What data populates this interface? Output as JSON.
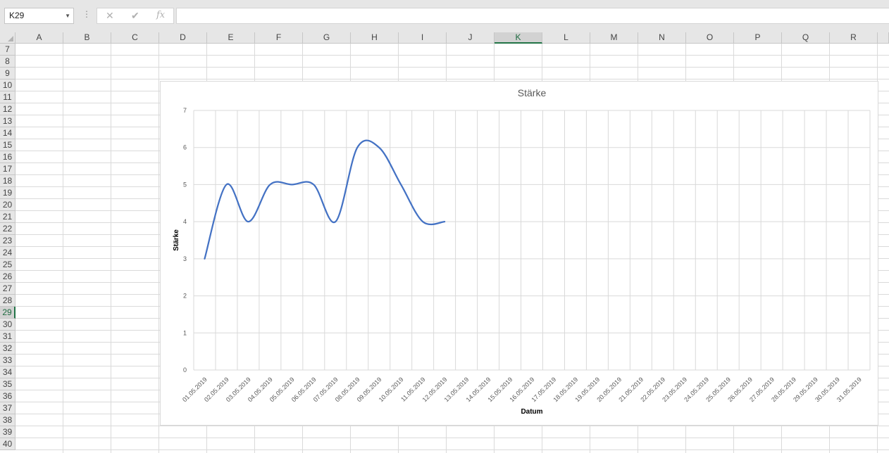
{
  "formula_bar": {
    "name_box": "K29",
    "cancel_icon": "✕",
    "enter_icon": "✔",
    "fx_icon": "fx",
    "formula_value": ""
  },
  "sheet": {
    "selected_cell": "K29",
    "columns": [
      "A",
      "B",
      "C",
      "D",
      "E",
      "F",
      "G",
      "H",
      "I",
      "J",
      "K",
      "L",
      "M",
      "N",
      "O",
      "P",
      "Q",
      "R"
    ],
    "rows": [
      "7",
      "8",
      "9",
      "10",
      "11",
      "12",
      "13",
      "14",
      "15",
      "16",
      "17",
      "18",
      "19",
      "20",
      "21",
      "22",
      "23",
      "24",
      "25",
      "26",
      "27",
      "28",
      "29",
      "30",
      "31",
      "32",
      "33",
      "34",
      "35",
      "36",
      "37",
      "38",
      "39",
      "40"
    ],
    "selected_column": "K",
    "selected_row": "29",
    "accent_color": "#217346"
  },
  "chart_data": {
    "type": "line",
    "title": "Stärke",
    "xlabel": "Datum",
    "ylabel": "Stärke",
    "ylim": [
      0,
      7
    ],
    "yticks": [
      "0",
      "1",
      "2",
      "3",
      "4",
      "5",
      "6",
      "7"
    ],
    "categories": [
      "01.05.2019",
      "02.05.2019",
      "03.05.2019",
      "04.05.2019",
      "05.05.2019",
      "06.05.2019",
      "07.05.2019",
      "08.05.2019",
      "09.05.2019",
      "10.05.2019",
      "11.05.2019",
      "12.05.2019",
      "13.05.2019",
      "14.05.2019",
      "15.05.2019",
      "16.05.2019",
      "17.05.2019",
      "18.05.2019",
      "19.05.2019",
      "20.05.2019",
      "21.05.2019",
      "22.05.2019",
      "23.05.2019",
      "24.05.2019",
      "25.05.2019",
      "26.05.2019",
      "27.05.2019",
      "28.05.2019",
      "29.05.2019",
      "30.05.2019",
      "31.05.2019"
    ],
    "series": [
      {
        "values": [
          3,
          5,
          4,
          5,
          5,
          5,
          4,
          6,
          6,
          5,
          4,
          4
        ],
        "color": "#4472c4",
        "smooth": true
      }
    ],
    "grid": true,
    "legend": "none"
  }
}
